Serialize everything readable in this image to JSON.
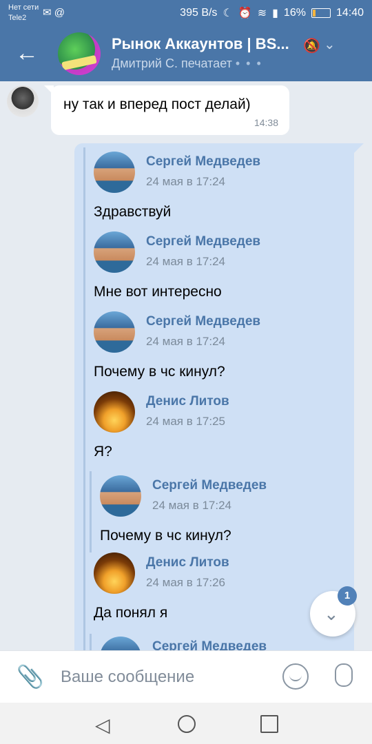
{
  "status_bar": {
    "network_line1": "Нет сети",
    "network_line2": "Tele2",
    "speed": "395 B/s",
    "battery": "16%",
    "time": "14:40"
  },
  "header": {
    "title": "Рынок Аккаунтов | BS...",
    "subtitle": "Дмитрий С. печатает",
    "typing_dots": "• • •"
  },
  "incoming": {
    "text": "ну так и вперед пост делай)",
    "time": "14:38"
  },
  "forwarded": [
    {
      "name": "Сергей Медведев",
      "date": "24 мая в 17:24",
      "text": "Здравствуй"
    },
    {
      "name": "Сергей Медведев",
      "date": "24 мая в 17:24",
      "text": "Мне вот интересно"
    },
    {
      "name": "Сергей Медведев",
      "date": "24 мая в 17:24",
      "text": "Почему в чс кинул?"
    },
    {
      "name": "Денис Литов",
      "date": "24 мая в 17:25",
      "text": "Я?"
    },
    {
      "name": "Сергей Медведев",
      "date": "24 мая в 17:24",
      "text": "Почему в чс кинул?"
    },
    {
      "name": "Денис Литов",
      "date": "24 мая в 17:26",
      "text": "Да понял я"
    },
    {
      "name": "Сергей Медведев"
    }
  ],
  "scroll_badge": "1",
  "composer": {
    "placeholder": "Ваше сообщение"
  }
}
